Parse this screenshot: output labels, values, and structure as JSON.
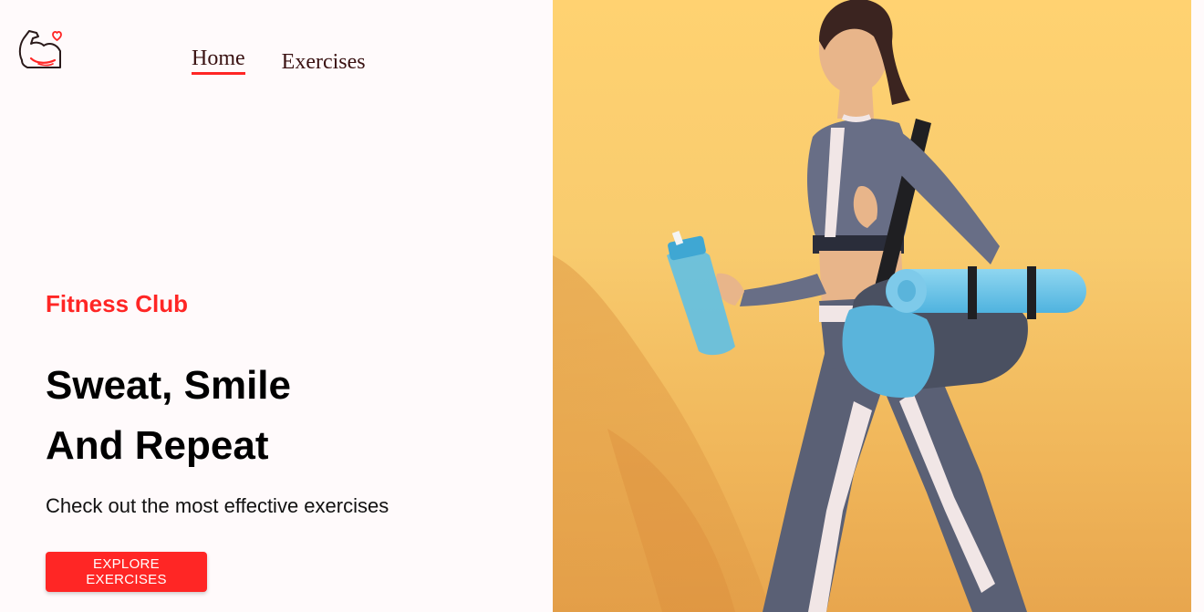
{
  "brand": {
    "logo_icon": "flexed-arm-heart-icon",
    "accent_color": "#ff2625"
  },
  "nav": {
    "items": [
      {
        "label": "Home",
        "active": true
      },
      {
        "label": "Exercises",
        "active": false
      }
    ]
  },
  "hero": {
    "subtitle": "Fitness Club",
    "title_line1": "Sweat, Smile",
    "title_line2": "And Repeat",
    "description": "Check out the most effective exercises",
    "cta_label": "EXPLORE EXERCISES",
    "image_icon": "woman-with-gym-bag-photo",
    "image_bg_color": "#ffd271"
  }
}
